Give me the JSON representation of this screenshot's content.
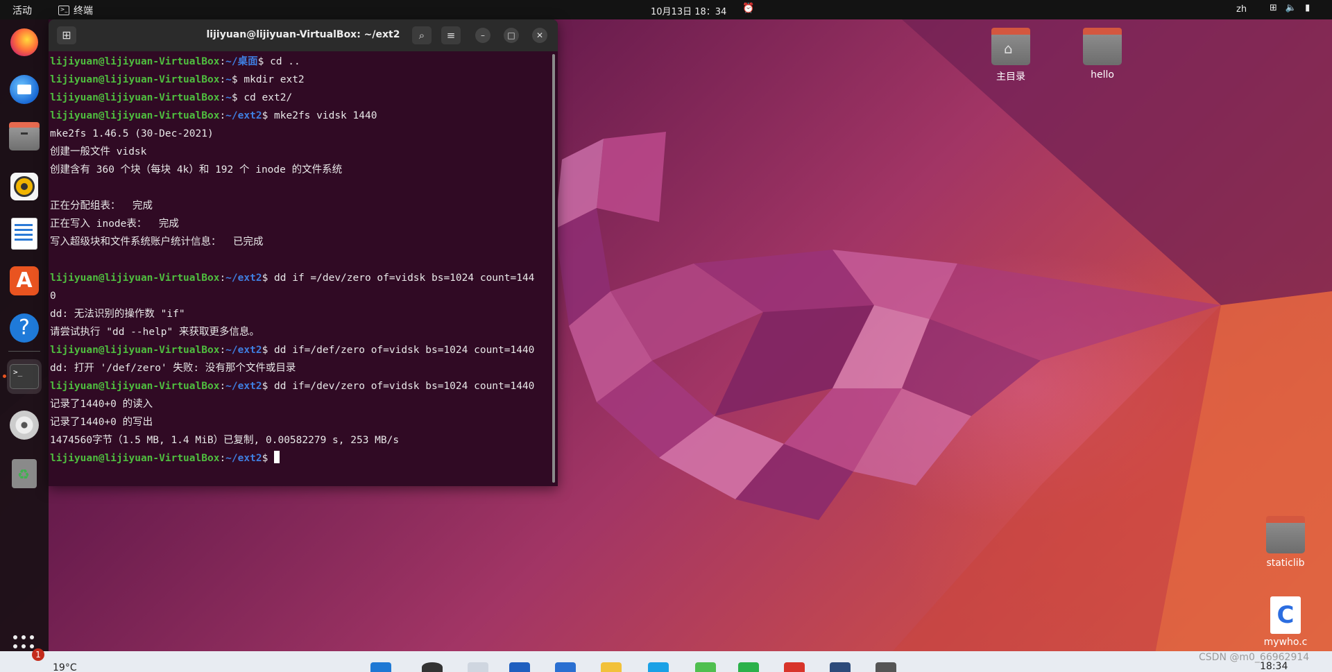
{
  "topbar": {
    "activities": "活动",
    "app_name": "终端",
    "clock": "10月13日  18：34",
    "lang": "zh"
  },
  "dock": {
    "items": [
      "firefox",
      "thunderbird",
      "files",
      "rhythmbox",
      "libreoffice-writer",
      "app-center",
      "help",
      "terminal",
      "disc",
      "trash"
    ],
    "active": "terminal"
  },
  "terminal": {
    "title": "lijiyuan@lijiyuan-VirtualBox: ~/ext2",
    "lines": [
      {
        "user": "lijiyuan@lijiyuan-VirtualBox",
        "path": "~/桌面",
        "cmd": "$ cd .."
      },
      {
        "user": "lijiyuan@lijiyuan-VirtualBox",
        "path": "~",
        "cmd": "$ mkdir ext2"
      },
      {
        "user": "lijiyuan@lijiyuan-VirtualBox",
        "path": "~",
        "cmd": "$ cd ext2/"
      },
      {
        "user": "lijiyuan@lijiyuan-VirtualBox",
        "path": "~/ext2",
        "cmd": "$ mke2fs vidsk 1440"
      },
      {
        "text": "mke2fs 1.46.5 (30-Dec-2021)"
      },
      {
        "text": "创建一般文件 vidsk"
      },
      {
        "text": "创建含有 360 个块（每块 4k）和 192 个 inode 的文件系统"
      },
      {
        "text": ""
      },
      {
        "text": "正在分配组表：  完成"
      },
      {
        "text": "正在写入 inode表：  完成"
      },
      {
        "text": "写入超级块和文件系统账户统计信息：  已完成"
      },
      {
        "text": ""
      },
      {
        "user": "lijiyuan@lijiyuan-VirtualBox",
        "path": "~/ext2",
        "cmd": "$ dd if =/dev/zero of=vidsk bs=1024 count=144"
      },
      {
        "text": "0"
      },
      {
        "text": "dd: 无法识别的操作数 \"if\""
      },
      {
        "text": "请尝试执行 \"dd --help\" 来获取更多信息。"
      },
      {
        "user": "lijiyuan@lijiyuan-VirtualBox",
        "path": "~/ext2",
        "cmd": "$ dd if=/def/zero of=vidsk bs=1024 count=1440"
      },
      {
        "text": "dd: 打开 '/def/zero' 失败: 没有那个文件或目录"
      },
      {
        "user": "lijiyuan@lijiyuan-VirtualBox",
        "path": "~/ext2",
        "cmd": "$ dd if=/dev/zero of=vidsk bs=1024 count=1440"
      },
      {
        "text": "记录了1440+0 的读入"
      },
      {
        "text": "记录了1440+0 的写出"
      },
      {
        "text": "1474560字节（1.5 MB, 1.4 MiB）已复制, 0.00582279 s, 253 MB/s"
      },
      {
        "user": "lijiyuan@lijiyuan-VirtualBox",
        "path": "~/ext2",
        "cmd": "$ ",
        "cursor": true
      }
    ]
  },
  "desktop": {
    "home": "主目录",
    "hello": "hello",
    "staticlib": "staticlib",
    "mywho": "mywho.c"
  },
  "host": {
    "badge": "1",
    "temp": "19°C",
    "time": "18:34",
    "watermark": "CSDN @m0_66962914"
  }
}
